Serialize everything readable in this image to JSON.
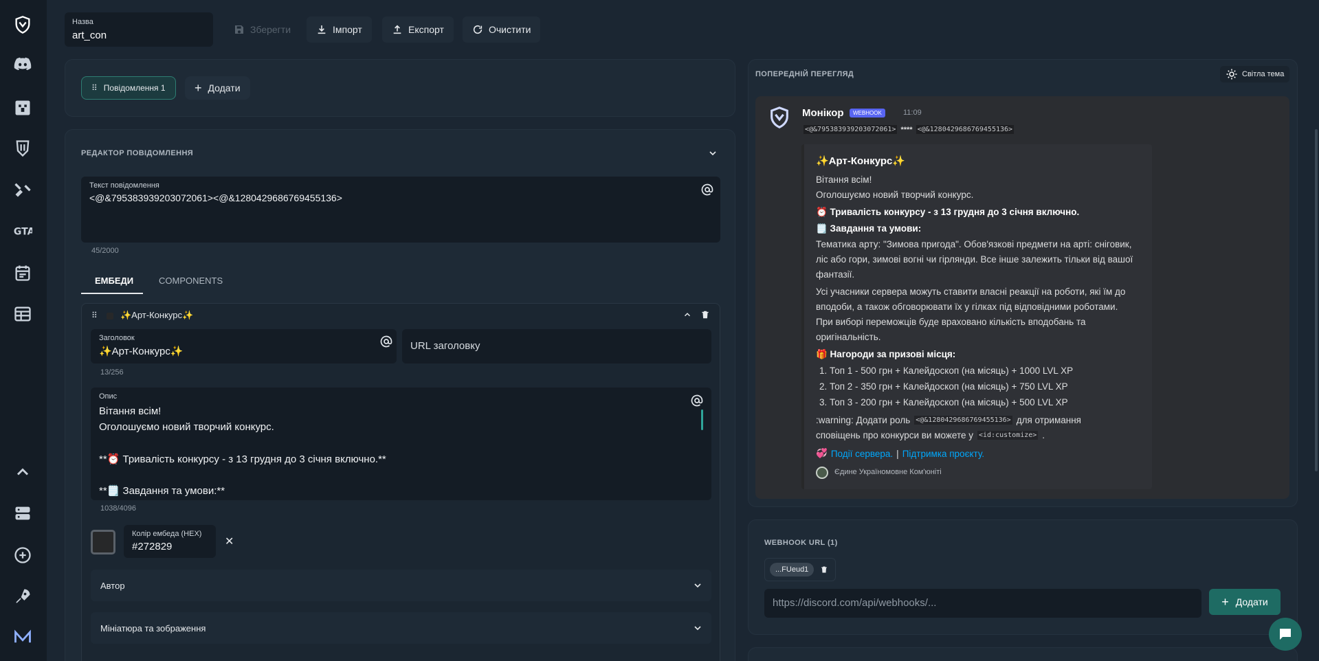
{
  "colors": {
    "background": "#1b2632",
    "sidebar": "#141c25",
    "panel": "#1e2a36",
    "accent_teal": "#1e6b63",
    "webhook_badge": "#5865f2",
    "embed_color": "#272829",
    "link": "#00a8fc"
  },
  "sidebar": {
    "icons": [
      "shield-logo-icon",
      "discord-icon",
      "minecraft-icon",
      "dota-icon",
      "gamepad-icon",
      "gta-icon",
      "calendar-icon",
      "table-icon",
      "chevron-up-icon",
      "server-icon",
      "plus-circle-icon",
      "rocket-icon",
      "m-logo-icon"
    ]
  },
  "topbar": {
    "name_label": "Назва",
    "name_value": "art_con",
    "save": "Зберегти",
    "import": "Імпорт",
    "export": "Експорт",
    "clear": "Очистити"
  },
  "messages": {
    "tab_label": "Повідомлення 1",
    "add_label": "Додати"
  },
  "editor": {
    "title": "РЕДАКТОР ПОВІДОМЛЕННЯ",
    "text_label": "Текст повідомлення",
    "text_value": "<@&795383939203072061><@&1280429686769455136>",
    "text_counter": "45/2000",
    "tabs": [
      "ЕМБЕДИ",
      "COMPONENTS"
    ],
    "embed": {
      "header_title": "✨Арт-Конкурс✨",
      "title_label": "Заголовок",
      "title_value": "✨Арт-Конкурс✨",
      "title_counter": "13/256",
      "url_placeholder": "URL заголовку",
      "desc_label": "Опис",
      "desc_lines": [
        "Вітання всім!",
        "Оголошуємо новий творчий конкурс.",
        "",
        "**⏰ Тривалість конкурсу - з 13 грудня до 3 січня включно.**",
        "",
        "**🗒️ Завдання та умови:**"
      ],
      "desc_counter": "1038/4096",
      "color_label": "Колір ембеда (HEX)",
      "color_value": "#272829",
      "author_label": "Автор",
      "images_label": "Мініатюра та зображення"
    }
  },
  "preview": {
    "title": "ПОПЕРЕДНІЙ ПЕРЕГЛЯД",
    "theme_label": "Світла тема",
    "bot_name": "Монікор",
    "badge": "WEBHOOK",
    "time": "11:09",
    "mention_1": "<@&795383939203072061>",
    "mention_sep": "****",
    "mention_2": "<@&1280429686769455136>",
    "embed_title": "✨Арт-Конкурс✨",
    "line_greeting": "Вітання всім!",
    "line_announce": "Оголошуємо новий творчий конкурс.",
    "line_duration": "⏰ Тривалість конкурсу - з 13 грудня до 3 січня включно.",
    "line_task_title": "🗒️ Завдання та умови:",
    "task_1": "Тематика арту: \"Зимова пригода\". Обов'язкові предмети на арті: сніговик,",
    "task_2": "ліс або гори, зимові вогні чи гірлянди. Все інше залежить тільки від вашої",
    "task_3": "фантазії.",
    "react_1": "Усі учасники сервера можуть ставити власні реакції на роботи, які їм до",
    "react_2": "вподоби, а також обговорювати їх у гілках під відповідними роботами.",
    "react_3": "При виборі переможців буде враховано кількість вподобань та",
    "react_4": "оригінальність.",
    "prizes_title": "🎁 Нагороди за призові місця:",
    "prizes": [
      "1. Топ 1 - 500 грн + Калейдоскоп (на місяць) + 1000 LVL XP",
      "2. Топ 2 - 350 грн + Калейдоскоп (на місяць) + 750 LVL XP",
      "3. Топ 3 - 200 грн + Калейдоскоп (на місяць) + 500 LVL XP"
    ],
    "warning_prefix": ":warning: Додати роль",
    "warning_role": "<@&1280429686769455136>",
    "warning_suffix": "для отримання",
    "notify_prefix": "сповіщень про конкурси ви можете у",
    "notify_code": "<id:customize>",
    "notify_dot": ".",
    "link_1": "Події сервера.",
    "link_sep": "|",
    "link_2": "Підтримка проєкту.",
    "footer": "Єдине Україномовне Ком'юніті"
  },
  "webhook": {
    "title": "WEBHOOK URL (1)",
    "chip": "...FUeud1",
    "input_placeholder": "https://discord.com/api/webhooks/...",
    "add_label": "Додати"
  }
}
